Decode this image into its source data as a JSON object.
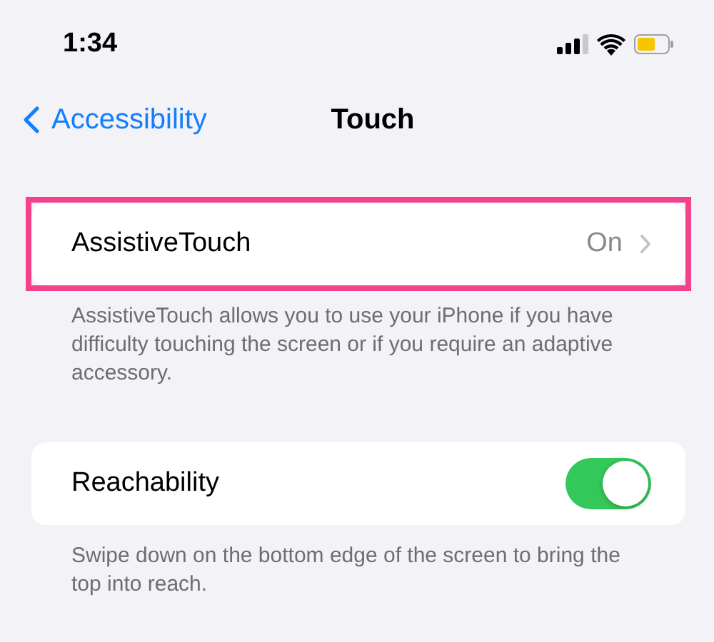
{
  "status_bar": {
    "time": "1:34"
  },
  "nav": {
    "back_label": "Accessibility",
    "title": "Touch"
  },
  "sections": [
    {
      "kind": "link",
      "label": "AssistiveTouch",
      "value": "On",
      "highlighted": true,
      "footer": "AssistiveTouch allows you to use your iPhone if you have difficulty touching the screen or if you require an adaptive accessory."
    },
    {
      "kind": "toggle",
      "label": "Reachability",
      "on": true,
      "highlighted": false,
      "footer": "Swipe down on the bottom edge of the screen to bring the top into reach."
    }
  ]
}
